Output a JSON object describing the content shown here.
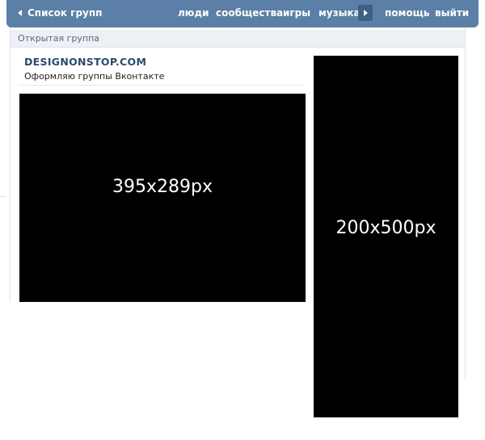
{
  "topbar": {
    "back_label": "Список групп",
    "nav": {
      "people": "люди",
      "communities": "сообщества",
      "games": "игры",
      "music": "музыка",
      "help": "помощь",
      "logout": "выйти"
    }
  },
  "group": {
    "type": "Открытая группа",
    "name": "DESIGNONSTOP.COM",
    "status": "Оформляю группы Вконтакте"
  },
  "images": {
    "main_cover": "395x289px",
    "side_avatar": "200x500px"
  },
  "colors": {
    "topbar": "#5b7fa6",
    "topbar_button": "#3e5f86",
    "group_type_bar": "#edf0f4",
    "group_name": "#2b4a6e",
    "placeholder": "#000000"
  }
}
